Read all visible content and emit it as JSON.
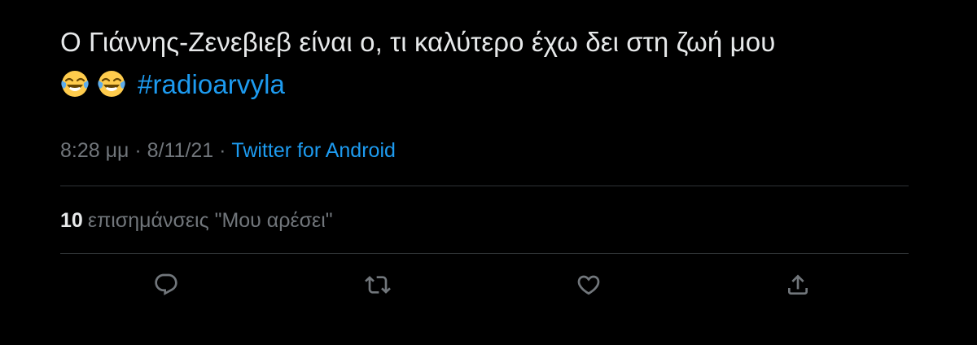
{
  "tweet": {
    "text_line1": "Ο Γιάννης-Ζενεβιεβ είναι ο, τι καλύτερο έχω δει στη ζωή μου",
    "emojis": [
      "face-with-tears-of-joy-icon",
      "face-with-tears-of-joy-icon"
    ],
    "hashtag": "#radioarvyla",
    "time": "8:28 μμ",
    "separator": " · ",
    "date": "8/11/21",
    "source": "Twitter for Android",
    "likes_count": "10",
    "likes_label": "επισημάνσεις \"Μου αρέσει\""
  },
  "actions": [
    {
      "name": "reply",
      "icon": "speech-bubble-icon"
    },
    {
      "name": "retweet",
      "icon": "retweet-arrows-icon"
    },
    {
      "name": "like",
      "icon": "heart-icon"
    },
    {
      "name": "share",
      "icon": "share-upload-icon"
    }
  ],
  "colors": {
    "background": "#000000",
    "text": "#e7e9ea",
    "secondary": "#71767b",
    "accent": "#1d9bf0",
    "divider": "#2f3336"
  }
}
